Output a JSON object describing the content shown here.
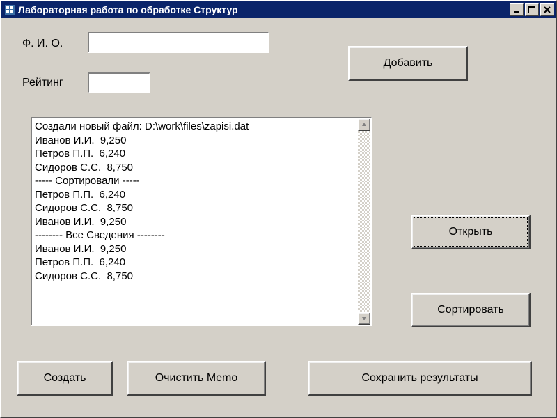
{
  "window": {
    "title": "Лабораторная работа по обработке Структур"
  },
  "labels": {
    "fio": "Ф. И. О.",
    "rating": "Рейтинг"
  },
  "inputs": {
    "fio": "",
    "rating": ""
  },
  "buttons": {
    "add": "Добавить",
    "open": "Открыть",
    "sort": "Сортировать",
    "create": "Создать",
    "clear_memo": "Очистить Memo",
    "save_results": "Сохранить результаты"
  },
  "memo": {
    "lines": [
      "Создали новый файл: D:\\work\\files\\zapisi.dat",
      "Иванов И.И.  9,250",
      "Петров П.П.  6,240",
      "Сидоров С.С.  8,750",
      "----- Сортировали -----",
      "Петров П.П.  6,240",
      "Сидоров С.С.  8,750",
      "Иванов И.И.  9,250",
      "-------- Все Сведения --------",
      "Иванов И.И.  9,250",
      "Петров П.П.  6,240",
      "Сидоров С.С.  8,750"
    ]
  }
}
